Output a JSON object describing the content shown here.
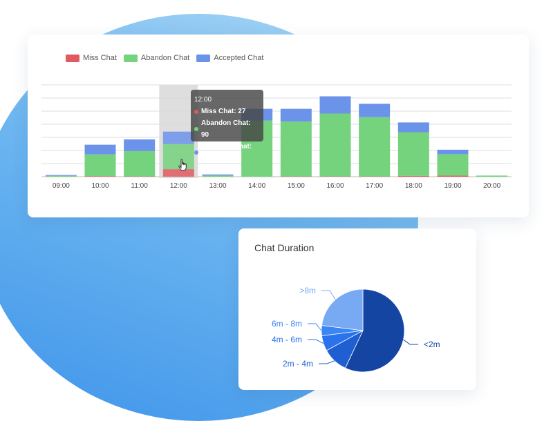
{
  "colors": {
    "miss": "#e05a5f",
    "abandon": "#75d27d",
    "accepted": "#6c93ea",
    "bar_panel_bg": "#ffffff"
  },
  "chart_data": [
    {
      "type": "bar",
      "stacked": true,
      "categories": [
        "09:00",
        "10:00",
        "11:00",
        "12:00",
        "13:00",
        "14:00",
        "15:00",
        "16:00",
        "17:00",
        "18:00",
        "19:00",
        "20:00"
      ],
      "series": [
        {
          "name": "Miss Chat",
          "values": [
            0,
            2,
            1,
            27,
            0,
            0,
            1,
            1,
            1,
            3,
            4,
            0
          ]
        },
        {
          "name": "Abandon Chat",
          "values": [
            3,
            78,
            91,
            90,
            4,
            202,
            197,
            226,
            213,
            157,
            77,
            4
          ]
        },
        {
          "name": "Accepted Chat",
          "values": [
            3,
            35,
            42,
            45,
            4,
            42,
            46,
            62,
            48,
            35,
            16,
            0
          ]
        }
      ],
      "ylim": [
        0,
        330
      ],
      "grid": true,
      "legend": "top-left",
      "highlighted_category": "12:00",
      "tooltip": {
        "title": "12:00",
        "rows": [
          {
            "label": "Miss Chat: 27"
          },
          {
            "label": "Abandon Chat: 90"
          },
          {
            "label": "Accepted Chat: 45"
          }
        ]
      }
    },
    {
      "type": "pie",
      "title": "Chat Duration",
      "categories": [
        "<2m",
        "2m - 4m",
        "4m - 6m",
        "6m - 8m",
        ">8m"
      ],
      "values": [
        57,
        10,
        6,
        4,
        23
      ],
      "colors": [
        "#1545a3",
        "#1f5fd1",
        "#2b73ec",
        "#3a86f5",
        "#78aaf3"
      ]
    }
  ]
}
